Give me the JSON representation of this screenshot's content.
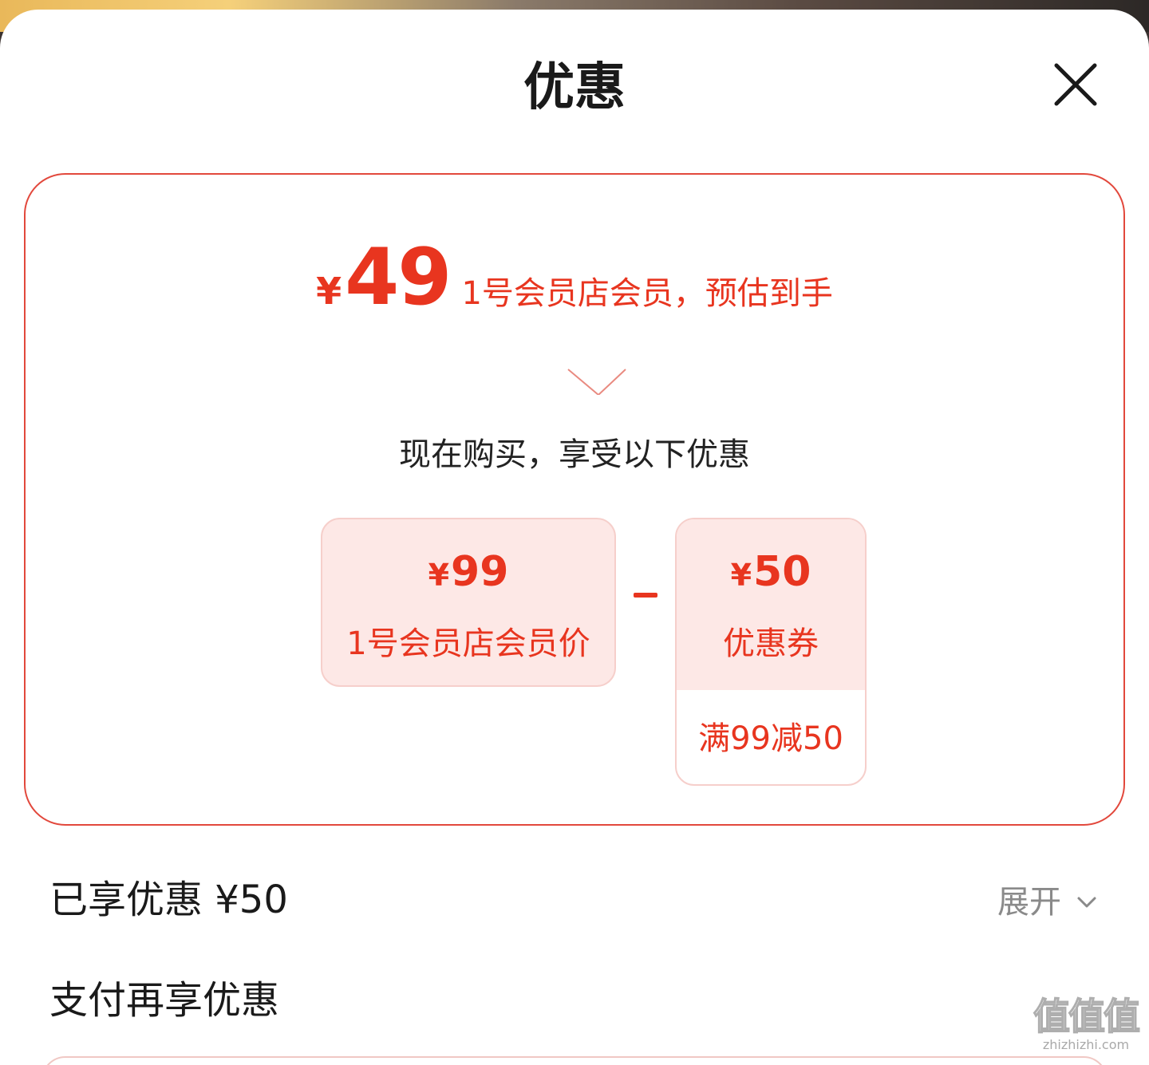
{
  "sheet": {
    "title": "优惠",
    "close_icon": "close-icon"
  },
  "estimate": {
    "currency": "¥",
    "amount": "49",
    "label": "1号会员店会员，预估到手"
  },
  "breakdown": {
    "intro": "现在购买，享受以下优惠",
    "member_price": {
      "currency": "¥",
      "value": "99",
      "label": "1号会员店会员价"
    },
    "operator": "-",
    "coupon": {
      "currency": "¥",
      "value": "50",
      "label": "优惠券",
      "condition": "满99减50"
    }
  },
  "summary": {
    "enjoyed_label": "已享优惠 ¥50",
    "expand_label": "展开",
    "expand_icon": "chevron-down-icon"
  },
  "pay_section": {
    "label": "支付再享优惠"
  },
  "watermark": {
    "glyphs": "值值值",
    "domain": "zhizhizhi.com"
  },
  "colors": {
    "accent_red": "#e8351f",
    "card_border": "#e2483c",
    "pink_fill": "#fde8e6",
    "muted_text": "#8a8a8a"
  }
}
